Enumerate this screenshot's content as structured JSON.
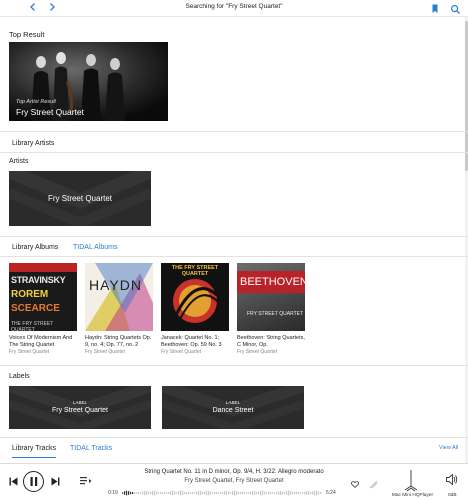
{
  "header": {
    "title": "Searching for \"Fry Street Quartet\"",
    "back_icon": "chevron-left-icon",
    "forward_icon": "chevron-right-icon",
    "bookmark_icon": "bookmark-icon",
    "search_icon": "search-icon"
  },
  "top_result": {
    "section_title": "Top Result",
    "subtitle": "Top Artist Result",
    "name": "Fry Street Quartet"
  },
  "library_artists": {
    "tab_label": "Library Artists",
    "section_title": "Artists",
    "artist_name": "Fry Street Quartet"
  },
  "albums": {
    "tabs": [
      "Library Albums",
      "TIDAL Albums"
    ],
    "items": [
      {
        "title": "Voices Of Modernism And The String Quartet",
        "artist": "Fry Street Quartet",
        "cover_lines": [
          "STRAVINSKY",
          "ROREM",
          "SCEARCE"
        ],
        "cover_footer": "THE FRY STREET QUARTET"
      },
      {
        "title": "Haydn: String Quartets Op. 9, no. 4; Op. 77, no. 2",
        "artist": "Fry Street Quartet",
        "cover_lines": [
          "HAYDN"
        ],
        "cover_footer": ""
      },
      {
        "title": "Janacek: Quartet No. 1; Beethoven: Op. 59 No. 3",
        "artist": "Fry Street Quartet",
        "cover_lines": [
          "THE FRY STREET QUARTET"
        ],
        "cover_footer": ""
      },
      {
        "title": "Beethoven: String Quartets, C Minor, Op.",
        "artist": "Fry Street Quartet",
        "cover_lines": [
          "BEETHOVEN"
        ],
        "cover_footer": "FRY STREET QUARTET"
      }
    ]
  },
  "labels": {
    "section_title": "Labels",
    "items": [
      {
        "kicker": "LABEL",
        "name": "Fry Street Quartet"
      },
      {
        "kicker": "LABEL",
        "name": "Dance Street"
      }
    ]
  },
  "tracks": {
    "tabs": [
      "Library Tracks",
      "TIDAL Tracks"
    ],
    "view_all": "View All"
  },
  "player": {
    "track": "String Quartet No. 11 in D minor, Op. 9/4, H. 3/22: Allegro moderato",
    "artists": "Fry Street Quartet, Fry Street Quartet",
    "elapsed": "0:19",
    "duration": "5:24",
    "progress": 0.06,
    "device": "Mac Mini HQPlayer",
    "volume": "0dB",
    "accent": "#2a7fd4"
  }
}
